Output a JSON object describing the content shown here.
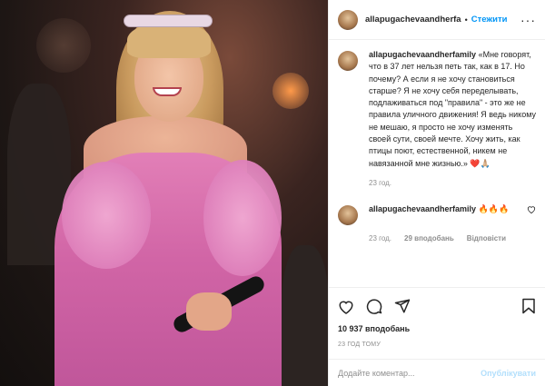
{
  "header": {
    "username": "allapugachevaandherfa",
    "separator": "•",
    "follow_label": "Стежити",
    "more_label": "···"
  },
  "caption": {
    "username": "allapugachevaandherfamily",
    "text": "«Мне говорят, что в 37 лет нельзя петь так, как в 17. Но почему? А если я не хочу становиться старше? Я не хочу себя переделывать, подлаживаться под \"правила\" - это же не правила уличного движения! Я ведь никому не мешаю, я просто не хочу изменять своей сути, своей мечте. Хочу жить, как птицы поют, естественной, никем не навязанной мне жизнью.» ❤️🙏🏼",
    "time": "23 год."
  },
  "reply": {
    "username": "allapugachevaandherfamily",
    "text": "🔥🔥🔥",
    "time": "23 год.",
    "likes": "29 вподобань",
    "reply_label": "Відповісти"
  },
  "actions": {
    "likes_count": "10 937 вподобань",
    "posted_ago": "23 ГОД ТОМУ"
  },
  "comment_box": {
    "placeholder": "Додайте коментар...",
    "post_label": "Опублікувати"
  },
  "colors": {
    "accent": "#0095f6",
    "post_disabled": "#b2dffc",
    "muted": "#8e8e8e",
    "dress": "#d165a6"
  }
}
